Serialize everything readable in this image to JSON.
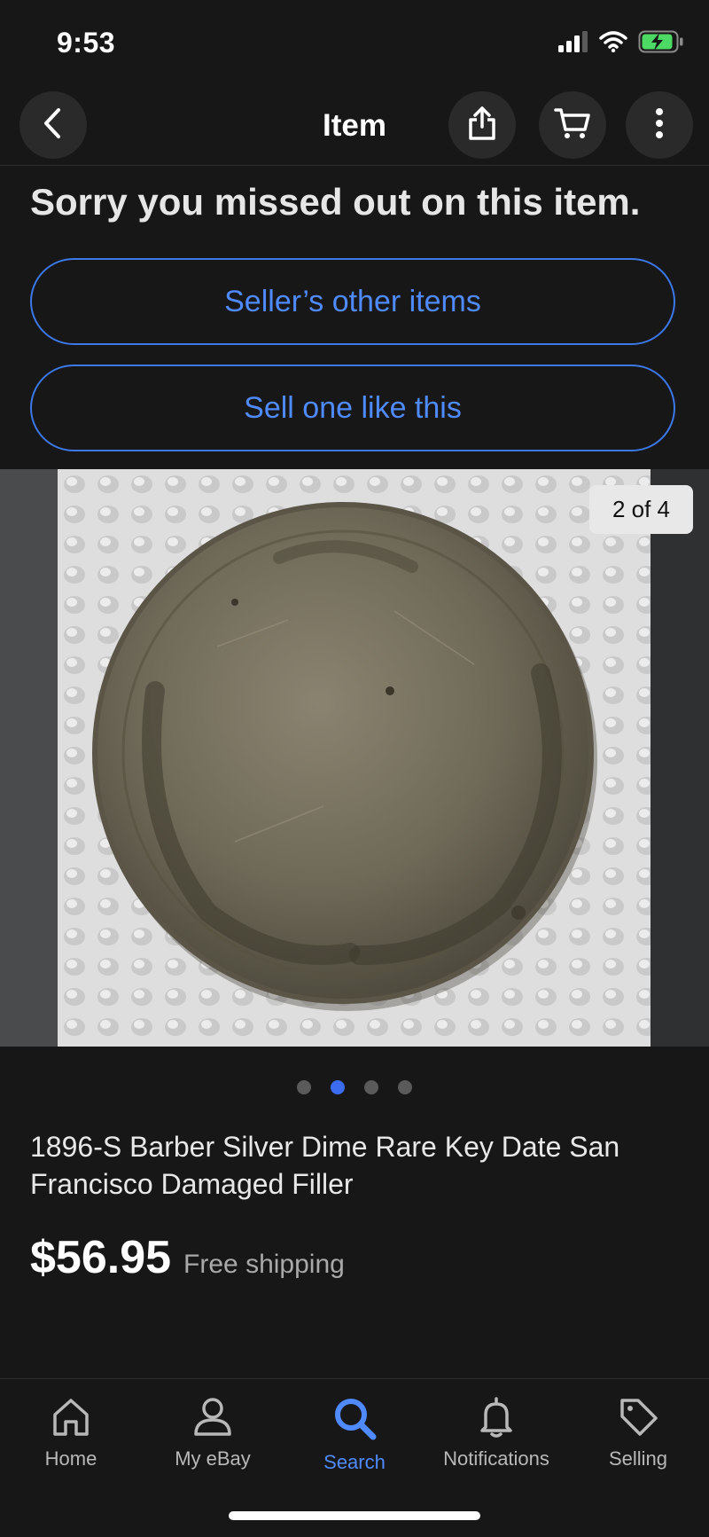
{
  "status_bar": {
    "time": "9:53"
  },
  "nav": {
    "title": "Item",
    "back_icon": "chevron-left-icon",
    "share_icon": "share-icon",
    "cart_icon": "cart-icon",
    "more_icon": "more-vertical-icon"
  },
  "notice": {
    "message": "Sorry you missed out on this item."
  },
  "actions": {
    "sellers_other_items": "Seller’s other items",
    "sell_one_like_this": "Sell one like this"
  },
  "gallery": {
    "counter": "2 of 4",
    "current_index": 2,
    "total": 4
  },
  "item": {
    "title": "1896-S Barber Silver Dime Rare Key Date San Francisco Damaged Filler",
    "price": "$56.95",
    "shipping": "Free shipping"
  },
  "tabs": [
    {
      "label": "Home",
      "icon": "home-icon"
    },
    {
      "label": "My eBay",
      "icon": "user-icon"
    },
    {
      "label": "Search",
      "icon": "search-icon",
      "active": true
    },
    {
      "label": "Notifications",
      "icon": "bell-icon"
    },
    {
      "label": "Selling",
      "icon": "tag-icon"
    }
  ],
  "colors": {
    "background": "#171717",
    "accent": "#3b6cf0",
    "link": "#4f8bff",
    "battery": "#4cd964"
  }
}
